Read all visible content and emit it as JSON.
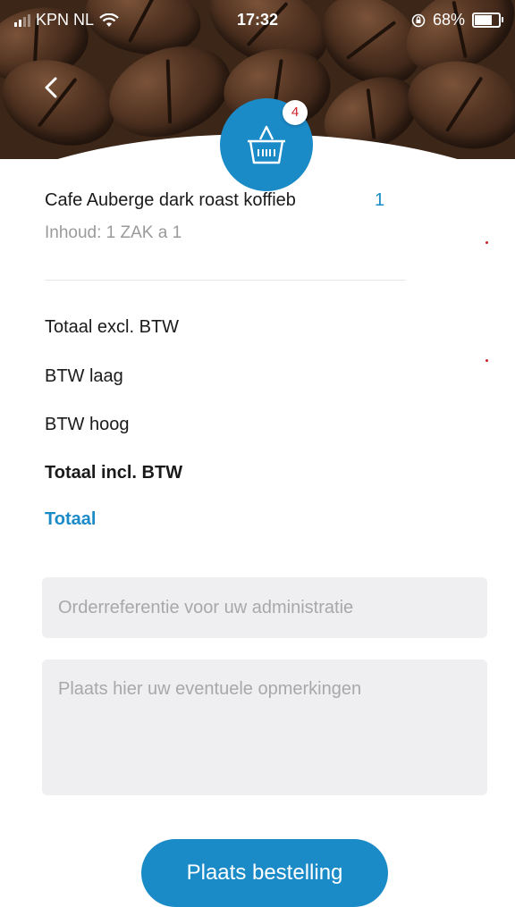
{
  "status_bar": {
    "carrier": "KPN NL",
    "time": "17:32",
    "battery": "68%"
  },
  "header": {
    "back_icon": "chevron-left-icon",
    "cart_icon": "basket-icon",
    "cart_count": "4"
  },
  "product": {
    "name": "Cafe Auberge dark roast koffieb",
    "quantity": "1",
    "content": "Inhoud: 1 ZAK a 1"
  },
  "totals": {
    "excl_label": "Totaal excl. BTW",
    "low_label": "BTW laag",
    "high_label": "BTW hoog",
    "incl_label": "Totaal incl. BTW",
    "total_label": "Totaal"
  },
  "form": {
    "reference_placeholder": "Orderreferentie voor uw administratie",
    "notes_placeholder": "Plaats hier uw eventuele opmerkingen"
  },
  "actions": {
    "order_label": "Plaats bestelling"
  },
  "colors": {
    "accent": "#1b8bc8",
    "badge_text": "#d0202a"
  }
}
